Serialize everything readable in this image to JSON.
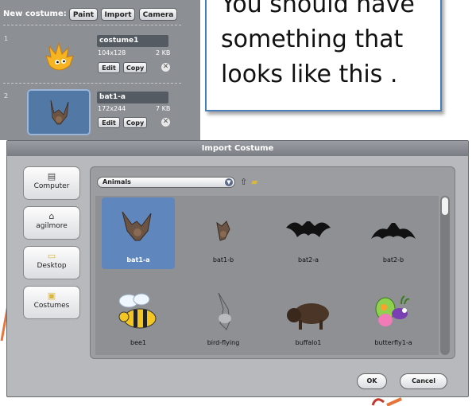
{
  "costume_panel": {
    "new_costume_label": "New costume:",
    "buttons": {
      "paint": "Paint",
      "import": "Import",
      "camera": "Camera"
    },
    "costumes": [
      {
        "number": "1",
        "name": "costume1",
        "dims": "104x128",
        "size": "2 KB",
        "edit": "Edit",
        "copy": "Copy",
        "delete": "✕"
      },
      {
        "number": "2",
        "name": "bat1-a",
        "dims": "172x244",
        "size": "7 KB",
        "edit": "Edit",
        "copy": "Copy",
        "delete": "✕"
      }
    ]
  },
  "callout": {
    "lines": [
      "You should have",
      "something that",
      "looks like this ."
    ]
  },
  "dialog": {
    "title": "Import Costume",
    "sidebar": [
      {
        "label": "Computer",
        "icon": "computer-icon"
      },
      {
        "label": "agilmore",
        "icon": "home-icon"
      },
      {
        "label": "Desktop",
        "icon": "folder-icon"
      },
      {
        "label": "Costumes",
        "icon": "costumes-folder-icon"
      }
    ],
    "folder_select": "Animals",
    "items": [
      {
        "label": "bat1-a"
      },
      {
        "label": "bat1-b"
      },
      {
        "label": "bat2-a"
      },
      {
        "label": "bat2-b"
      },
      {
        "label": "bee1"
      },
      {
        "label": "bird-flying"
      },
      {
        "label": "buffalo1"
      },
      {
        "label": "butterfly1-a"
      }
    ],
    "ok": "OK",
    "cancel": "Cancel"
  },
  "colors": {
    "selected_item": "#5f87bd",
    "callout_border": "#4a7ebb",
    "accent_orange": "#e8743a"
  }
}
